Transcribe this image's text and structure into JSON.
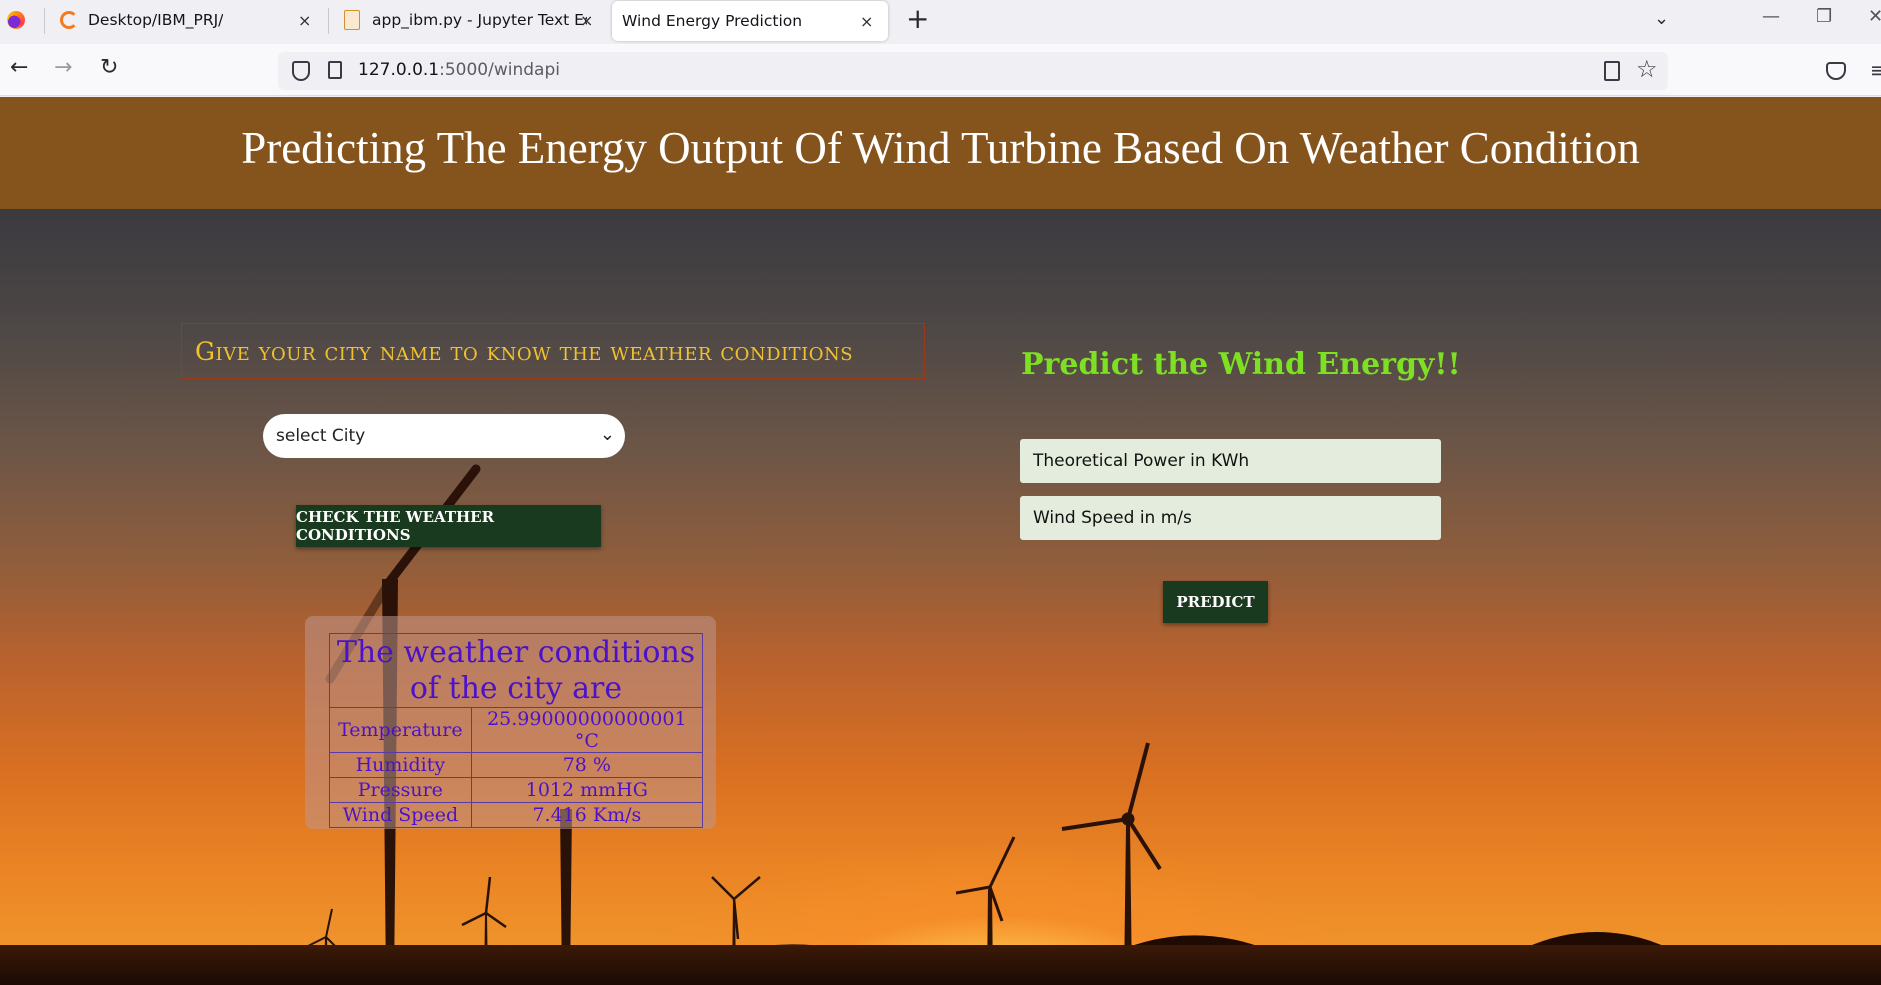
{
  "browser": {
    "tabs": [
      {
        "title": "Desktop/IBM_PRJ/",
        "icon": "loading-icon",
        "close": "×"
      },
      {
        "title": "app_ibm.py - Jupyter Text Editor",
        "icon": "document-icon",
        "close": "×"
      },
      {
        "title": "Wind Energy Prediction",
        "icon": "",
        "close": "×",
        "active": true
      }
    ],
    "new_tab": "+",
    "tab_list": "⌄",
    "window_controls": {
      "minimize": "—",
      "restore": "❐",
      "close": "✕"
    },
    "nav": {
      "back": "←",
      "forward": "→",
      "reload": "↻"
    },
    "url": {
      "host": "127.0.0.1",
      "path": ":5000/windapi"
    },
    "star": "☆",
    "menu": "≡"
  },
  "page": {
    "title": "Predicting The Energy Output Of Wind Turbine Based On Weather Condition",
    "city_section": {
      "heading": "Give your city name to know the weather conditions",
      "select_value": "select City",
      "select_chevron": "⌄",
      "check_button": "CHECK THE WEATHER CONDITIONS"
    },
    "weather": {
      "caption": "The weather conditions of the city are",
      "rows": [
        {
          "label": "Temperature",
          "value": "25.99000000000001 °C"
        },
        {
          "label": "Humidity",
          "value": "78 %"
        },
        {
          "label": "Pressure",
          "value": "1012 mmHG"
        },
        {
          "label": "Wind Speed",
          "value": "7.416 Km/s"
        }
      ]
    },
    "predict_section": {
      "title": "Predict the Wind Energy!!",
      "power_placeholder": "Theoretical Power in KWh",
      "speed_placeholder": "Wind Speed in m/s",
      "predict_button": "PREDICT"
    }
  },
  "colors": {
    "header_bg": "#85531c",
    "button_bg": "#1a3a20",
    "heading_gold": "#f2c12e",
    "predict_green": "#7ee022",
    "weather_text": "#4c12c9"
  }
}
